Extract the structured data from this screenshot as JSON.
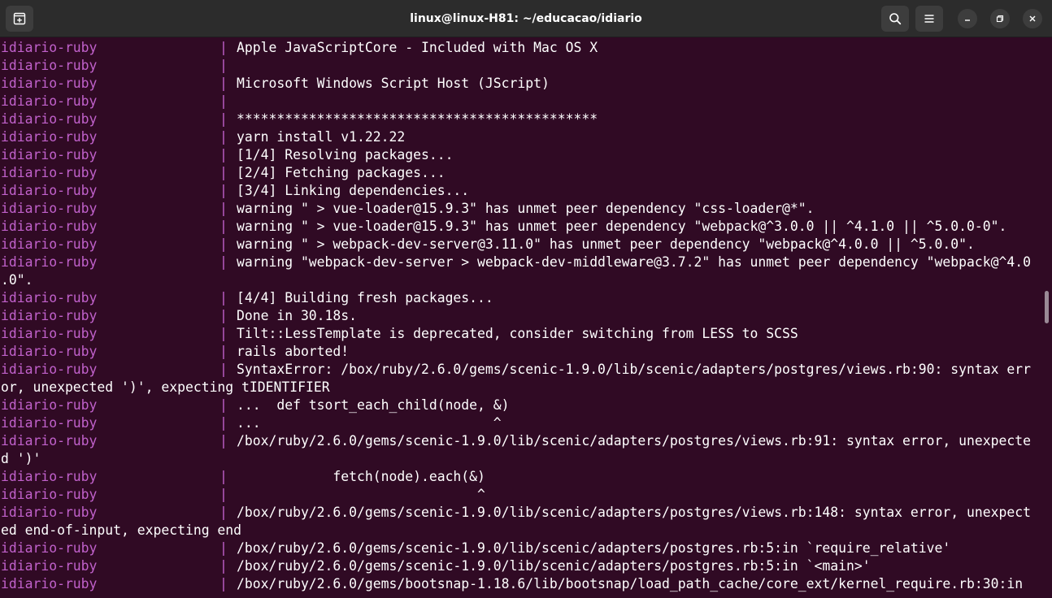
{
  "window": {
    "title": "linux@linux-H81: ~/educacao/idiario"
  },
  "titlebar": {
    "new_tab_icon": "new-tab-icon",
    "search_icon": "search-icon",
    "menu_icon": "hamburger-menu-icon",
    "minimize_icon": "minimize-icon",
    "maximize_icon": "maximize-icon",
    "close_icon": "close-icon"
  },
  "colors": {
    "terminal_bg": "#300a24",
    "service_prefix": "#c061cb",
    "text": "#ffffff",
    "titlebar_bg": "#2c2c2c"
  },
  "terminal": {
    "service": "idiario-ruby",
    "separator": "|",
    "lines": [
      {
        "svc": "idiario-ruby",
        "sep": "|",
        "msg": "Apple JavaScriptCore - Included with Mac OS X"
      },
      {
        "svc": "idiario-ruby",
        "sep": "|",
        "msg": ""
      },
      {
        "svc": "idiario-ruby",
        "sep": "|",
        "msg": "Microsoft Windows Script Host (JScript)"
      },
      {
        "svc": "idiario-ruby",
        "sep": "|",
        "msg": ""
      },
      {
        "svc": "idiario-ruby",
        "sep": "|",
        "msg": "*********************************************"
      },
      {
        "svc": "idiario-ruby",
        "sep": "|",
        "msg": "yarn install v1.22.22"
      },
      {
        "svc": "idiario-ruby",
        "sep": "|",
        "msg": "[1/4] Resolving packages..."
      },
      {
        "svc": "idiario-ruby",
        "sep": "|",
        "msg": "[2/4] Fetching packages..."
      },
      {
        "svc": "idiario-ruby",
        "sep": "|",
        "msg": "[3/4] Linking dependencies..."
      },
      {
        "svc": "idiario-ruby",
        "sep": "|",
        "msg": "warning \" > vue-loader@15.9.3\" has unmet peer dependency \"css-loader@*\"."
      },
      {
        "svc": "idiario-ruby",
        "sep": "|",
        "msg": "warning \" > vue-loader@15.9.3\" has unmet peer dependency \"webpack@^3.0.0 || ^4.1.0 || ^5.0.0-0\"."
      },
      {
        "svc": "idiario-ruby",
        "sep": "|",
        "msg": "warning \" > webpack-dev-server@3.11.0\" has unmet peer dependency \"webpack@^4.0.0 || ^5.0.0\"."
      },
      {
        "svc": "idiario-ruby",
        "sep": "|",
        "msg": "warning \"webpack-dev-server > webpack-dev-middleware@3.7.2\" has unmet peer dependency \"webpack@^4.0"
      },
      {
        "cont": ".0\"."
      },
      {
        "svc": "idiario-ruby",
        "sep": "|",
        "msg": "[4/4] Building fresh packages..."
      },
      {
        "svc": "idiario-ruby",
        "sep": "|",
        "msg": "Done in 30.18s."
      },
      {
        "svc": "idiario-ruby",
        "sep": "|",
        "msg": "Tilt::LessTemplate is deprecated, consider switching from LESS to SCSS"
      },
      {
        "svc": "idiario-ruby",
        "sep": "|",
        "msg": "rails aborted!"
      },
      {
        "svc": "idiario-ruby",
        "sep": "|",
        "msg": "SyntaxError: /box/ruby/2.6.0/gems/scenic-1.9.0/lib/scenic/adapters/postgres/views.rb:90: syntax err"
      },
      {
        "cont": "or, unexpected ')', expecting tIDENTIFIER"
      },
      {
        "svc": "idiario-ruby",
        "sep": "|",
        "msg": "...  def tsort_each_child(node, &)"
      },
      {
        "svc": "idiario-ruby",
        "sep": "|",
        "msg": "...                             ^"
      },
      {
        "svc": "idiario-ruby",
        "sep": "|",
        "msg": "/box/ruby/2.6.0/gems/scenic-1.9.0/lib/scenic/adapters/postgres/views.rb:91: syntax error, unexpecte"
      },
      {
        "cont": "d ')'"
      },
      {
        "svc": "idiario-ruby",
        "sep": "|",
        "msg": "            fetch(node).each(&)"
      },
      {
        "svc": "idiario-ruby",
        "sep": "|",
        "msg": "                              ^"
      },
      {
        "svc": "idiario-ruby",
        "sep": "|",
        "msg": "/box/ruby/2.6.0/gems/scenic-1.9.0/lib/scenic/adapters/postgres/views.rb:148: syntax error, unexpect"
      },
      {
        "cont": "ed end-of-input, expecting end"
      },
      {
        "svc": "idiario-ruby",
        "sep": "|",
        "msg": "/box/ruby/2.6.0/gems/scenic-1.9.0/lib/scenic/adapters/postgres.rb:5:in `require_relative'"
      },
      {
        "svc": "idiario-ruby",
        "sep": "|",
        "msg": "/box/ruby/2.6.0/gems/scenic-1.9.0/lib/scenic/adapters/postgres.rb:5:in `<main>'"
      },
      {
        "svc": "idiario-ruby",
        "sep": "|",
        "msg": "/box/ruby/2.6.0/gems/bootsnap-1.18.6/lib/bootsnap/load_path_cache/core_ext/kernel_require.rb:30:in"
      }
    ]
  }
}
